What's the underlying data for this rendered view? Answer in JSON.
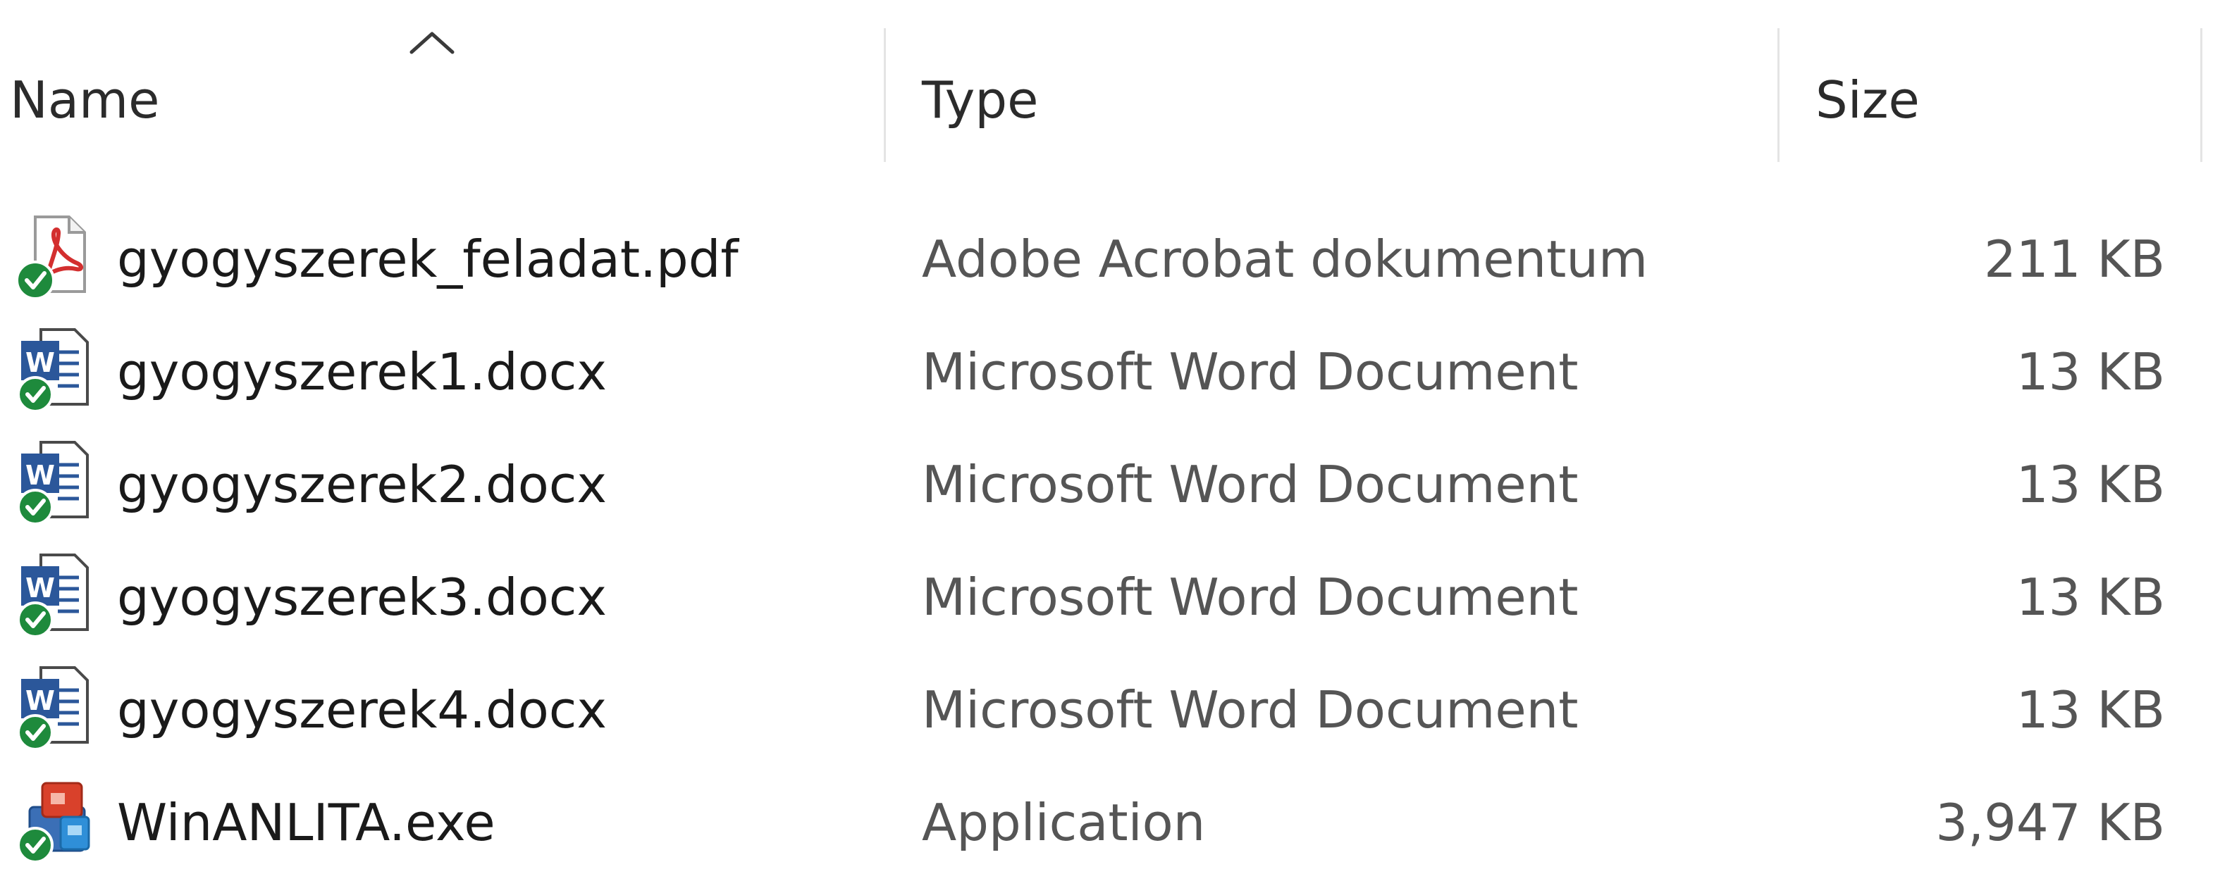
{
  "columns": {
    "name": "Name",
    "type": "Type",
    "size": "Size"
  },
  "sort": {
    "column": "name",
    "direction": "ascending",
    "icon": "sort-up-chevron-icon"
  },
  "files": [
    {
      "name": "gyogyszerek_feladat.pdf",
      "type": "Adobe Acrobat dokumentum",
      "size": "211 KB",
      "icon": "pdf-file-icon",
      "sync_status": "synced-check-icon"
    },
    {
      "name": "gyogyszerek1.docx",
      "type": "Microsoft Word Document",
      "size": "13 KB",
      "icon": "word-document-icon",
      "sync_status": "synced-check-icon"
    },
    {
      "name": "gyogyszerek2.docx",
      "type": "Microsoft Word Document",
      "size": "13 KB",
      "icon": "word-document-icon",
      "sync_status": "synced-check-icon"
    },
    {
      "name": "gyogyszerek3.docx",
      "type": "Microsoft Word Document",
      "size": "13 KB",
      "icon": "word-document-icon",
      "sync_status": "synced-check-icon"
    },
    {
      "name": "gyogyszerek4.docx",
      "type": "Microsoft Word Document",
      "size": "13 KB",
      "icon": "word-document-icon",
      "sync_status": "synced-check-icon"
    },
    {
      "name": "WinANLITA.exe",
      "type": "Application",
      "size": "3,947 KB",
      "icon": "application-exe-icon",
      "sync_status": "synced-check-icon"
    }
  ],
  "colors": {
    "pdf_red": "#d32f2f",
    "word_blue": "#2b579a",
    "sync_green": "#1e8a3c",
    "header_text": "#2b2b2b",
    "secondary_text": "#555555"
  }
}
